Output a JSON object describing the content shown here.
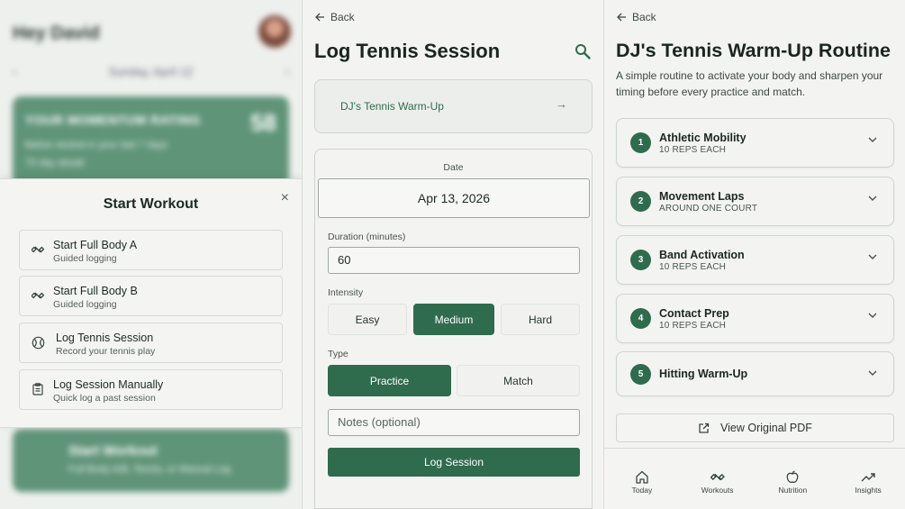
{
  "home": {
    "greeting": "Hey David",
    "date": "Sunday, April 12",
    "prev": "‹",
    "next": "›",
    "momentum": {
      "title": "YOUR MOMENTUM RATING",
      "value": "58",
      "subtitle": "Below neutral in your last 7 days",
      "streak": "75 day streak"
    },
    "start_card": {
      "title": "Start Workout",
      "subtitle": "Full Body A/B, Tennis, or Manual Log"
    }
  },
  "sheet": {
    "title": "Start Workout",
    "close": "×",
    "options": [
      {
        "title": "Start Full Body A",
        "subtitle": "Guided logging",
        "icon": "dumbbell-icon"
      },
      {
        "title": "Start Full Body B",
        "subtitle": "Guided logging",
        "icon": "dumbbell-icon"
      },
      {
        "title": "Log Tennis Session",
        "subtitle": "Record your tennis play",
        "icon": "tennis-ball-icon"
      },
      {
        "title": "Log Session Manually",
        "subtitle": "Quick log a past session",
        "icon": "clipboard-icon"
      }
    ]
  },
  "tennis": {
    "back": "Back",
    "title": "Log Tennis Session",
    "routine_link": "DJ's Tennis Warm-Up",
    "routine_arrow": "→",
    "date_label": "Date",
    "date_value": "Apr 13, 2026",
    "duration_label": "Duration (minutes)",
    "duration_value": "60",
    "intensity_label": "Intensity",
    "intensity_options": [
      "Easy",
      "Medium",
      "Hard"
    ],
    "intensity_selected": "Medium",
    "type_label": "Type",
    "type_options": [
      "Practice",
      "Match"
    ],
    "type_selected": "Practice",
    "notes_placeholder": "Notes (optional)",
    "submit": "Log Session"
  },
  "routine": {
    "back": "Back",
    "title": "DJ's Tennis Warm-Up Routine",
    "description": "A simple routine to activate your body and sharpen your timing before every practice and match.",
    "steps": [
      {
        "num": "1",
        "title": "Athletic Mobility",
        "sub": "10 REPS EACH"
      },
      {
        "num": "2",
        "title": "Movement Laps",
        "sub": "AROUND ONE COURT"
      },
      {
        "num": "3",
        "title": "Band Activation",
        "sub": "10 REPS EACH"
      },
      {
        "num": "4",
        "title": "Contact Prep",
        "sub": "10 REPS EACH"
      },
      {
        "num": "5",
        "title": "Hitting Warm-Up",
        "sub": ""
      }
    ],
    "pdf_button": "View Original PDF"
  },
  "tabbar": [
    {
      "label": "Today",
      "icon": "home-icon"
    },
    {
      "label": "Workouts",
      "icon": "dumbbell-icon"
    },
    {
      "label": "Nutrition",
      "icon": "apple-icon"
    },
    {
      "label": "Insights",
      "icon": "trend-icon"
    }
  ],
  "colors": {
    "accent": "#2f6b4d",
    "momentum_bg": "#5f9478",
    "background": "#f3f4f2"
  }
}
